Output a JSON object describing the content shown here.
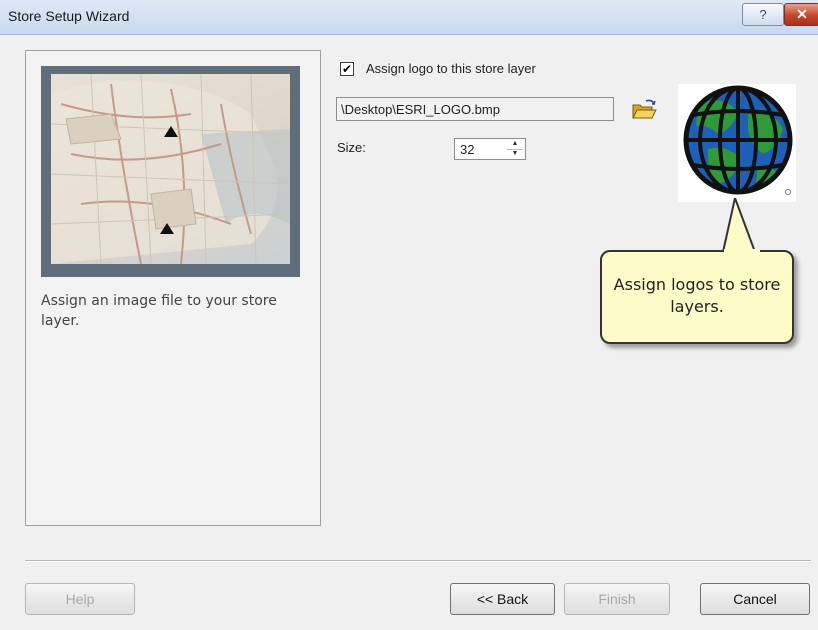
{
  "window": {
    "title": "Store Setup Wizard",
    "help_glyph": "?",
    "close_glyph": "✕",
    "help_icon": "question-icon",
    "close_icon": "close-icon"
  },
  "left_panel": {
    "description": "Assign an image file to your store layer.",
    "preview_icon": "map-preview-image"
  },
  "form": {
    "assign_logo_label": "Assign logo to this store layer",
    "assign_logo_checked": true,
    "checkbox_glyph": "✔",
    "file_path": "\\Desktop\\ESRI_LOGO.bmp",
    "browse_icon": "folder-open-icon",
    "size_label": "Size:",
    "size_value": "32",
    "spin_up_glyph": "▲",
    "spin_down_glyph": "▼"
  },
  "logo": {
    "icon": "globe-logo-icon",
    "colors": {
      "ocean": "#1f5fb8",
      "land": "#2e9a3a",
      "grid": "#111111"
    }
  },
  "callout": {
    "text": "Assign logos to store layers.",
    "background": "#fdfcc8"
  },
  "footer": {
    "help_label": "Help",
    "back_label": "<< Back",
    "finish_label": "Finish",
    "cancel_label": "Cancel"
  }
}
